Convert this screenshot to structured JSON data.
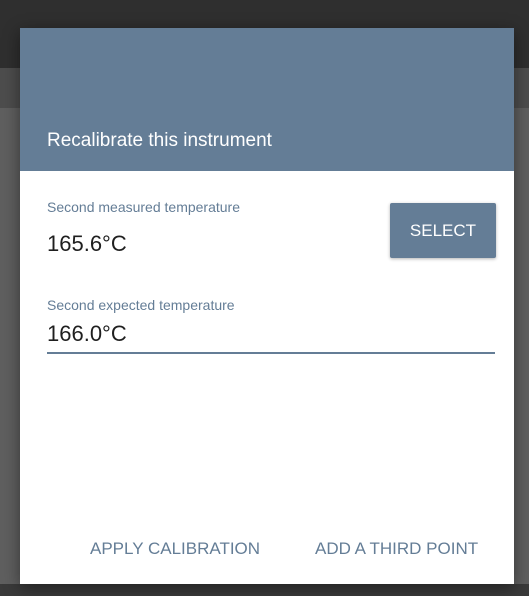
{
  "dialog": {
    "title": "Recalibrate this instrument",
    "measured": {
      "label": "Second measured temperature",
      "value": "165.6°C",
      "select_label": "SELECT"
    },
    "expected": {
      "label": "Second expected temperature",
      "value": "166.0°C"
    },
    "actions": {
      "apply_label": "APPLY CALIBRATION",
      "add_third_label": "ADD A THIRD POINT"
    }
  },
  "colors": {
    "accent": "#647d96",
    "overlay_dark": "#2f2f2f",
    "overlay": "#5f5f5f",
    "dialog_bg": "#ffffff",
    "text": "#1f1f1f"
  }
}
